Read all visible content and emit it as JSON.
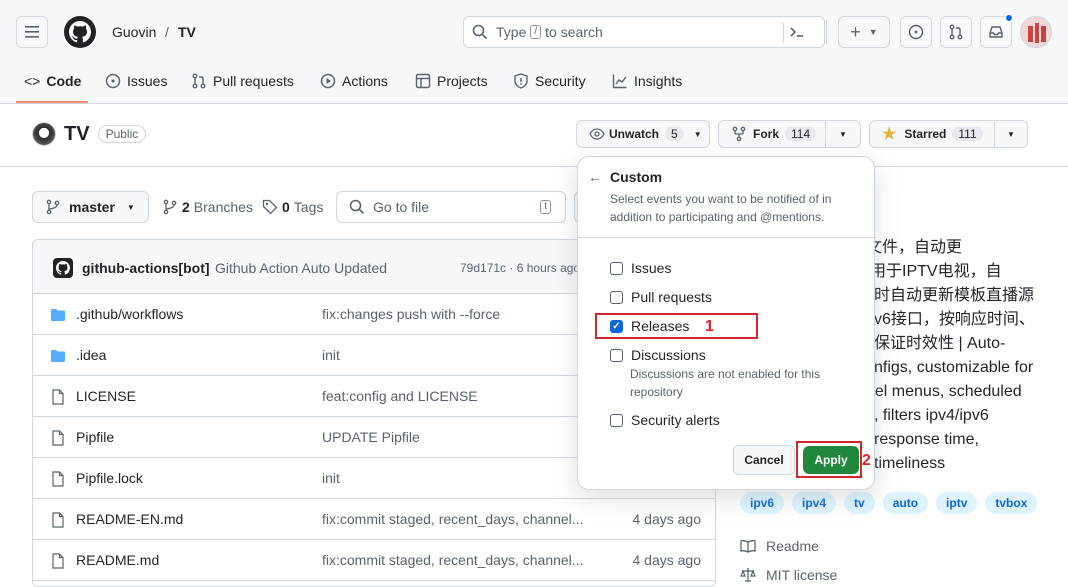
{
  "header": {
    "owner": "Guovin",
    "separator": "/",
    "repo": "TV",
    "search_pre": "Type",
    "search_key": "/",
    "search_post": "to search"
  },
  "nav": {
    "code": "Code",
    "issues": "Issues",
    "pull_requests": "Pull requests",
    "actions": "Actions",
    "projects": "Projects",
    "security": "Security",
    "insights": "Insights"
  },
  "repo": {
    "name": "TV",
    "visibility": "Public",
    "unwatch_label": "Unwatch",
    "watch_count": "5",
    "fork_label": "Fork",
    "fork_count": "114",
    "starred_label": "Starred",
    "star_count": "111"
  },
  "toolbar": {
    "branch": "master",
    "branches_count": "2",
    "branches_label": "Branches",
    "tags_count": "0",
    "tags_label": "Tags",
    "goto_placeholder": "Go to file",
    "goto_key": "t"
  },
  "commit": {
    "author": "github-actions[bot]",
    "message": "Github Action Auto Updated",
    "sha_time": "79d171c · 6 hours ago"
  },
  "files": [
    {
      "name": ".github/workflows",
      "msg": "fix:changes push with --force",
      "date": "",
      "type": "folder"
    },
    {
      "name": ".idea",
      "msg": "init",
      "date": "",
      "type": "folder"
    },
    {
      "name": "LICENSE",
      "msg": "feat:config and LICENSE",
      "date": "",
      "type": "file"
    },
    {
      "name": "Pipfile",
      "msg": "UPDATE Pipfile",
      "date": "",
      "type": "file"
    },
    {
      "name": "Pipfile.lock",
      "msg": "init",
      "date": "",
      "type": "file"
    },
    {
      "name": "README-EN.md",
      "msg": "fix:commit staged, recent_days, channel...",
      "date": "4 days ago",
      "type": "file"
    },
    {
      "name": "README.md",
      "msg": "fix:commit staged, recent_days, channel...",
      "date": "4 days ago",
      "type": "file"
    }
  ],
  "about": {
    "lines": [
      "彩迷配置文件，自动更",
      "，可用于IPTV电视，自",
      "时自动更新模板直播源",
      "v6接口，按响应时间、",
      "保证时效性 | Auto-",
      "nfigs, customizable for",
      "nel menus, scheduled",
      ", filters ipv4/ipv6",
      "response time,",
      "timeliness"
    ],
    "topics": [
      "ipv6",
      "ipv4",
      "tv",
      "auto",
      "iptv",
      "tvbox"
    ],
    "readme": "Readme",
    "license": "MIT license"
  },
  "dropdown": {
    "title": "Custom",
    "description": "Select events you want to be notified of in addition to participating and @mentions.",
    "options": [
      {
        "label": "Issues",
        "checked": false
      },
      {
        "label": "Pull requests",
        "checked": false
      },
      {
        "label": "Releases",
        "checked": true
      },
      {
        "label": "Discussions",
        "checked": false
      },
      {
        "label": "Security alerts",
        "checked": false
      }
    ],
    "discussions_note": "Discussions are not enabled for this repository",
    "cancel_label": "Cancel",
    "apply_label": "Apply",
    "marker_1": "1",
    "marker_2": "2"
  },
  "colors": {
    "apply_green": "#1f883d",
    "annotation_red": "#d1242f",
    "checkbox_blue": "#0969da",
    "topic_bg": "#ddf4ff"
  }
}
